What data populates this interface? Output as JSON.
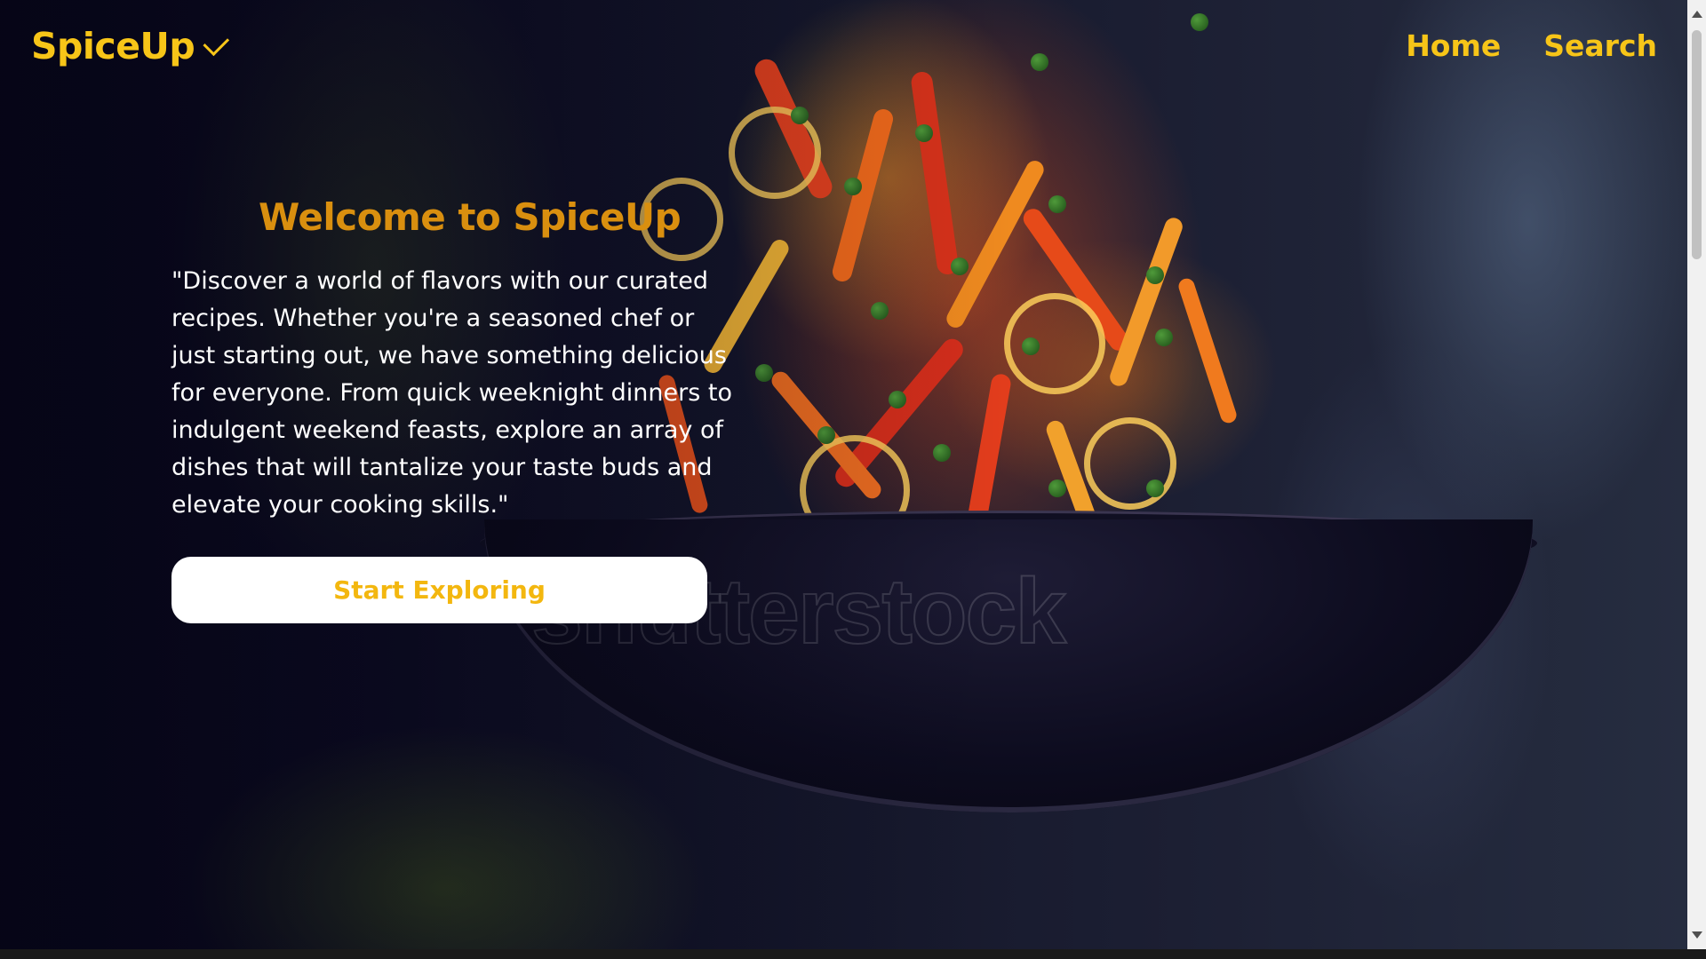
{
  "brand": {
    "name": "SpiceUp",
    "icon": "check-icon",
    "color": "#f7c518"
  },
  "nav": {
    "items": [
      {
        "label": "Home"
      },
      {
        "label": "Search"
      }
    ]
  },
  "hero": {
    "title": "Welcome to SpiceUp",
    "description": "\"Discover a world of flavors with our curated recipes. Whether you're a seasoned chef or just starting out, we have something delicious for everyone. From quick weeknight dinners to indulgent weekend feasts, explore an array of dishes that will tantalize your taste buds and elevate your cooking skills.\"",
    "cta_label": "Start Exploring",
    "watermark": "shutterstock",
    "title_color": "#d98f0f",
    "cta_text_color": "#f3b70f"
  }
}
